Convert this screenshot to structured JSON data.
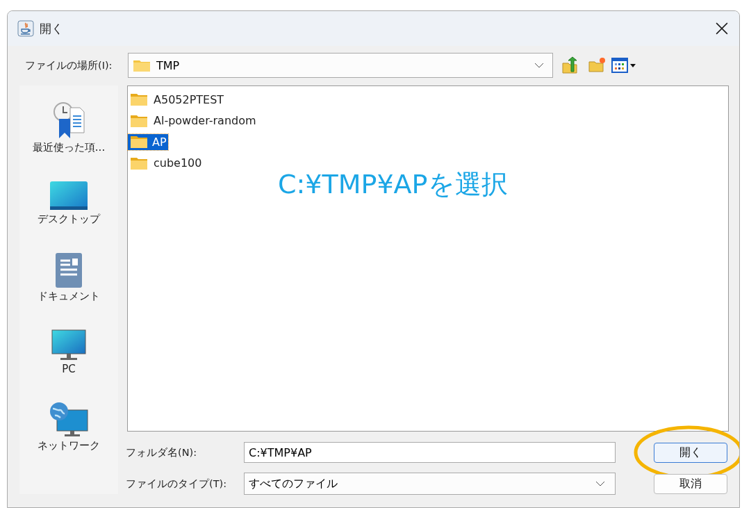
{
  "window": {
    "title": "開く"
  },
  "location": {
    "label": "ファイルの場所(I):",
    "value": "TMP"
  },
  "sidebar": {
    "items": [
      {
        "label": "最近使った項...",
        "kind": "recent"
      },
      {
        "label": "デスクトップ",
        "kind": "desktop"
      },
      {
        "label": "ドキュメント",
        "kind": "documents"
      },
      {
        "label": "PC",
        "kind": "pc"
      },
      {
        "label": "ネットワーク",
        "kind": "network"
      }
    ]
  },
  "files": [
    {
      "name": "A5052PTEST",
      "selected": false
    },
    {
      "name": "Al-powder-random",
      "selected": false
    },
    {
      "name": "AP",
      "selected": true
    },
    {
      "name": "cube100",
      "selected": false
    }
  ],
  "annotation": {
    "text": "C:¥TMP¥APを選択"
  },
  "folder_name": {
    "label": "フォルダ名(N):",
    "value": "C:¥TMP¥AP"
  },
  "file_type": {
    "label": "ファイルのタイプ(T):",
    "value": "すべてのファイル"
  },
  "buttons": [
    {
      "label": "開く",
      "circled": true
    },
    {
      "label": "取消",
      "circled": false
    }
  ]
}
